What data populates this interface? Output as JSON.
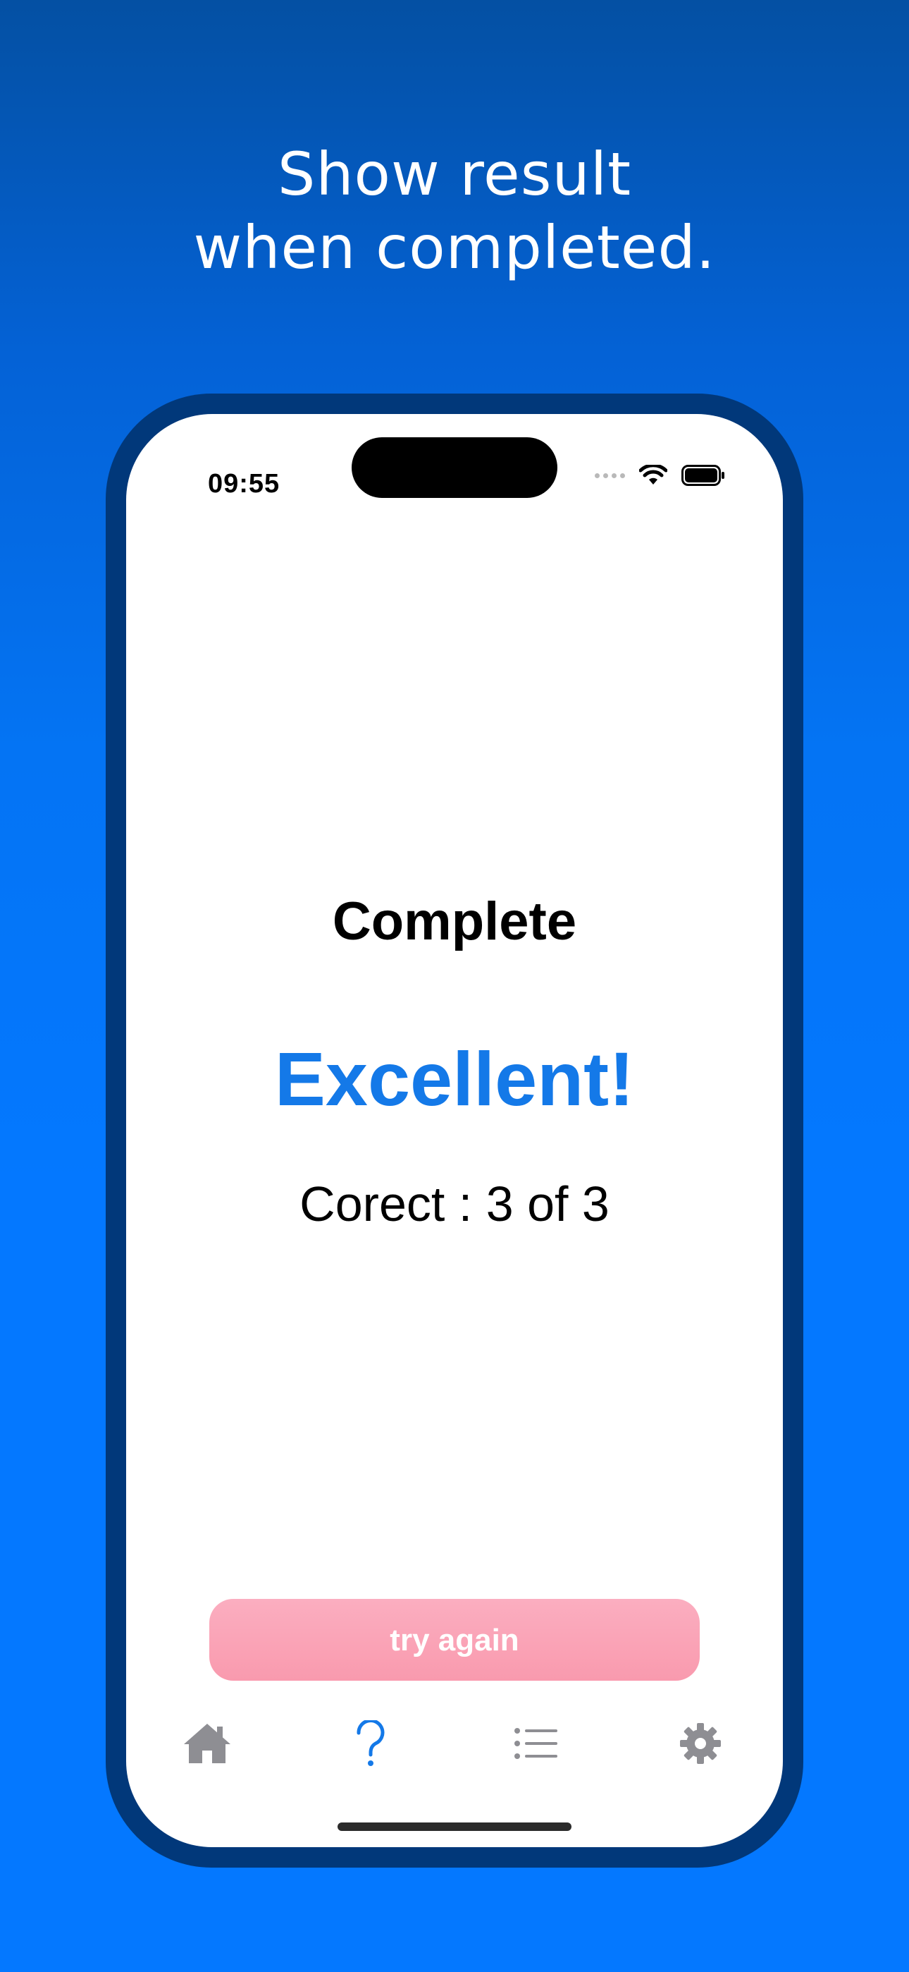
{
  "promo": {
    "line1": "Show result",
    "line2": "when completed."
  },
  "status_bar": {
    "time": "09:55"
  },
  "result": {
    "title": "Complete",
    "rating": "Excellent!",
    "score": "Corect : 3 of 3"
  },
  "actions": {
    "try_again_label": "try again"
  },
  "tabbar": {
    "items": [
      {
        "icon": "home-icon",
        "active": false
      },
      {
        "icon": "question-icon",
        "active": true
      },
      {
        "icon": "list-icon",
        "active": false
      },
      {
        "icon": "gear-icon",
        "active": false
      }
    ]
  },
  "colors": {
    "accent": "#1479e8",
    "button": "#f99aae",
    "frame": "#01387a",
    "tab_inactive": "#8e8e93"
  }
}
